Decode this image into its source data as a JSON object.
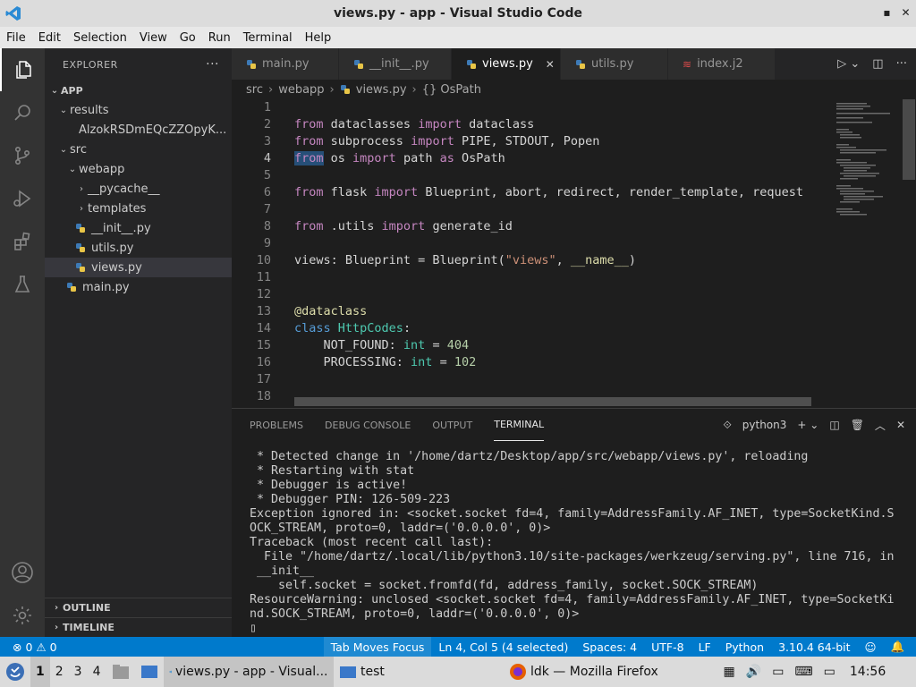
{
  "window": {
    "title": "views.py - app - Visual Studio Code",
    "minimize": "▪",
    "close": "✕"
  },
  "menu": [
    "File",
    "Edit",
    "Selection",
    "View",
    "Go",
    "Run",
    "Terminal",
    "Help"
  ],
  "sidebar": {
    "header": "EXPLORER",
    "more": "···",
    "root": "APP",
    "items": [
      {
        "label": "results",
        "kind": "folder",
        "open": true,
        "depth": 1
      },
      {
        "label": "AlzokRSDmEQcZZOpyK...",
        "kind": "file",
        "depth": 2
      },
      {
        "label": "src",
        "kind": "folder",
        "open": true,
        "depth": 1
      },
      {
        "label": "webapp",
        "kind": "folder",
        "open": true,
        "depth": 2
      },
      {
        "label": "__pycache__",
        "kind": "folder",
        "open": false,
        "depth": 3
      },
      {
        "label": "templates",
        "kind": "folder",
        "open": false,
        "depth": 3
      },
      {
        "label": "__init__.py",
        "kind": "py",
        "depth": 3
      },
      {
        "label": "utils.py",
        "kind": "py",
        "depth": 3
      },
      {
        "label": "views.py",
        "kind": "py",
        "depth": 3,
        "selected": true
      },
      {
        "label": "main.py",
        "kind": "py",
        "depth": 2
      }
    ],
    "outline": "OUTLINE",
    "timeline": "TIMELINE"
  },
  "tabs": [
    {
      "label": "main.py",
      "icon": "python-file-icon"
    },
    {
      "label": "__init__.py",
      "icon": "python-file-icon"
    },
    {
      "label": "views.py",
      "icon": "python-file-icon",
      "active": true
    },
    {
      "label": "utils.py",
      "icon": "python-file-icon"
    },
    {
      "label": "index.j2",
      "icon": "jinja-file-icon"
    }
  ],
  "breadcrumb": {
    "a": "src",
    "b": "webapp",
    "c": "views.py",
    "d": "{} OsPath"
  },
  "editor": {
    "line_numbers": [
      "1",
      "2",
      "3",
      "4",
      "5",
      "6",
      "7",
      "8",
      "9",
      "10",
      "11",
      "12",
      "13",
      "14",
      "15",
      "16",
      "17",
      "18"
    ],
    "current_line": 4
  },
  "panel": {
    "tabs": [
      "PROBLEMS",
      "DEBUG CONSOLE",
      "OUTPUT",
      "TERMINAL"
    ],
    "active_tab": "TERMINAL",
    "terminal_name": "python3",
    "terminal_lines": [
      " * Detected change in '/home/dartz/Desktop/app/src/webapp/views.py', reloading",
      " * Restarting with stat",
      " * Debugger is active!",
      " * Debugger PIN: 126-509-223",
      "Exception ignored in: <socket.socket fd=4, family=AddressFamily.AF_INET, type=SocketKind.S",
      "OCK_STREAM, proto=0, laddr=('0.0.0.0', 0)>",
      "Traceback (most recent call last):",
      "  File \"/home/dartz/.local/lib/python3.10/site-packages/werkzeug/serving.py\", line 716, in",
      " __init__",
      "    self.socket = socket.fromfd(fd, address_family, socket.SOCK_STREAM)",
      "ResourceWarning: unclosed <socket.socket fd=4, family=AddressFamily.AF_INET, type=SocketKi",
      "nd.SOCK_STREAM, proto=0, laddr=('0.0.0.0', 0)>",
      "▯"
    ]
  },
  "status": {
    "errors": "0",
    "warnings": "0",
    "focus": "Tab Moves Focus",
    "position": "Ln 4, Col 5 (4 selected)",
    "spaces": "Spaces: 4",
    "encoding": "UTF-8",
    "eol": "LF",
    "language": "Python",
    "interpreter": "3.10.4 64-bit"
  },
  "taskbar": {
    "workspaces": [
      "1",
      "2",
      "3",
      "4"
    ],
    "apps": [
      {
        "label": "views.py - app - Visual...",
        "icon": "vscode-icon"
      },
      {
        "label": "test",
        "icon": "folder-icon"
      },
      {
        "label": "ldk — Mozilla Firefox",
        "icon": "firefox-icon"
      }
    ],
    "clock": "14:56"
  },
  "colors": {
    "accent": "#007acc",
    "activity": "#333333",
    "sidebar": "#252526",
    "editor": "#1e1e1e"
  }
}
